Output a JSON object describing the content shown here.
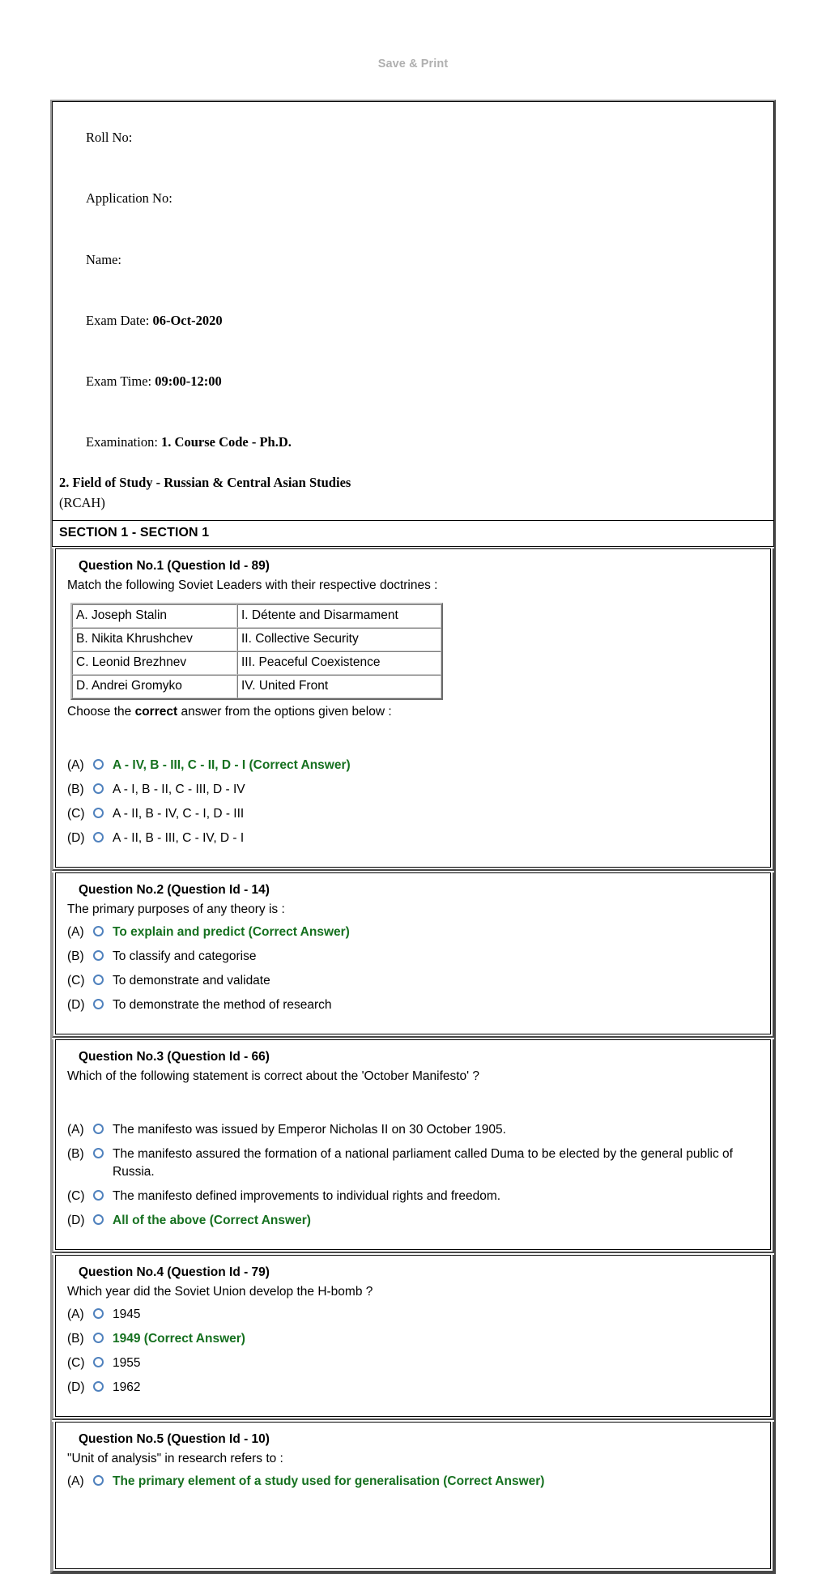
{
  "print_header": "Save & Print",
  "info": {
    "roll_no_label": "Roll No:",
    "application_no_label": "Application No:",
    "name_label": "Name:",
    "exam_date_label": "Exam Date: ",
    "exam_date_value": "06-Oct-2020",
    "exam_time_label": "Exam Time: ",
    "exam_time_value": "09:00-12:00",
    "examination_label": "Examination: ",
    "examination_value": "1. Course Code - Ph.D.",
    "examination_line2": "2. Field of Study - Russian & Central Asian Studies",
    "examination_line3": "(RCAH)"
  },
  "section": {
    "title": "SECTION 1 - SECTION 1"
  },
  "questions": [
    {
      "title": "Question No.1 (Question Id - 89)",
      "text": "Match the following Soviet Leaders with their respective doctrines :",
      "match_table": [
        {
          "left": "A.  Joseph Stalin",
          "right": "I.  Détente and Disarmament"
        },
        {
          "left": "B.  Nikita Khrushchev",
          "right": "II.  Collective Security"
        },
        {
          "left": "C.  Leonid Brezhnev",
          "right": "III.  Peaceful Coexistence"
        },
        {
          "left": "D.  Andrei Gromyko",
          "right": "IV.  United Front"
        }
      ],
      "choose_pre": "Choose the ",
      "choose_bold": "correct",
      "choose_post": " answer from the options given below :",
      "options": [
        {
          "letter": "(A)",
          "text": "A - IV, B - III, C - II, D - I (Correct Answer)",
          "correct": true
        },
        {
          "letter": "(B)",
          "text": "A - I, B - II, C - III, D - IV",
          "correct": false
        },
        {
          "letter": "(C)",
          "text": "A - II, B - IV, C - I, D - III",
          "correct": false
        },
        {
          "letter": "(D)",
          "text": "A - II, B - III, C - IV, D - I",
          "correct": false
        }
      ]
    },
    {
      "title": "Question No.2 (Question Id - 14)",
      "text": "The primary purposes of any theory is :",
      "options": [
        {
          "letter": "(A)",
          "text": "To explain and predict (Correct Answer)",
          "correct": true
        },
        {
          "letter": "(B)",
          "text": "To classify and categorise",
          "correct": false
        },
        {
          "letter": "(C)",
          "text": "To demonstrate and validate",
          "correct": false
        },
        {
          "letter": "(D)",
          "text": "To demonstrate the method of research",
          "correct": false
        }
      ]
    },
    {
      "title": "Question No.3 (Question Id - 66)",
      "text": "Which of the following statement is correct about the 'October Manifesto' ?",
      "options": [
        {
          "letter": "(A)",
          "text": "The manifesto was issued by Emperor Nicholas II on 30 October 1905.",
          "correct": false
        },
        {
          "letter": "(B)",
          "text": "The manifesto assured the formation of a national parliament called Duma to be elected by the general public of Russia.",
          "correct": false
        },
        {
          "letter": "(C)",
          "text": "The manifesto defined improvements to individual rights and freedom.",
          "correct": false
        },
        {
          "letter": "(D)",
          "text": "All of the above (Correct Answer)",
          "correct": true
        }
      ]
    },
    {
      "title": "Question No.4 (Question Id - 79)",
      "text": "Which year did the Soviet Union develop the H-bomb ?",
      "options": [
        {
          "letter": "(A)",
          "text": "1945",
          "correct": false
        },
        {
          "letter": "(B)",
          "text": "1949 (Correct Answer)",
          "correct": true
        },
        {
          "letter": "(C)",
          "text": "1955",
          "correct": false
        },
        {
          "letter": "(D)",
          "text": "1962",
          "correct": false
        }
      ]
    },
    {
      "title": "Question No.5 (Question Id - 10)",
      "text": "\"Unit of analysis\" in research refers to :",
      "options": [
        {
          "letter": "(A)",
          "text": "The primary element of a study used for generalisation (Correct Answer)",
          "correct": true
        }
      ]
    }
  ],
  "colors": {
    "correct_answer_green": "#15701f",
    "radio_blue": "#4f81bd",
    "header_gray": "#b0b0b0"
  }
}
